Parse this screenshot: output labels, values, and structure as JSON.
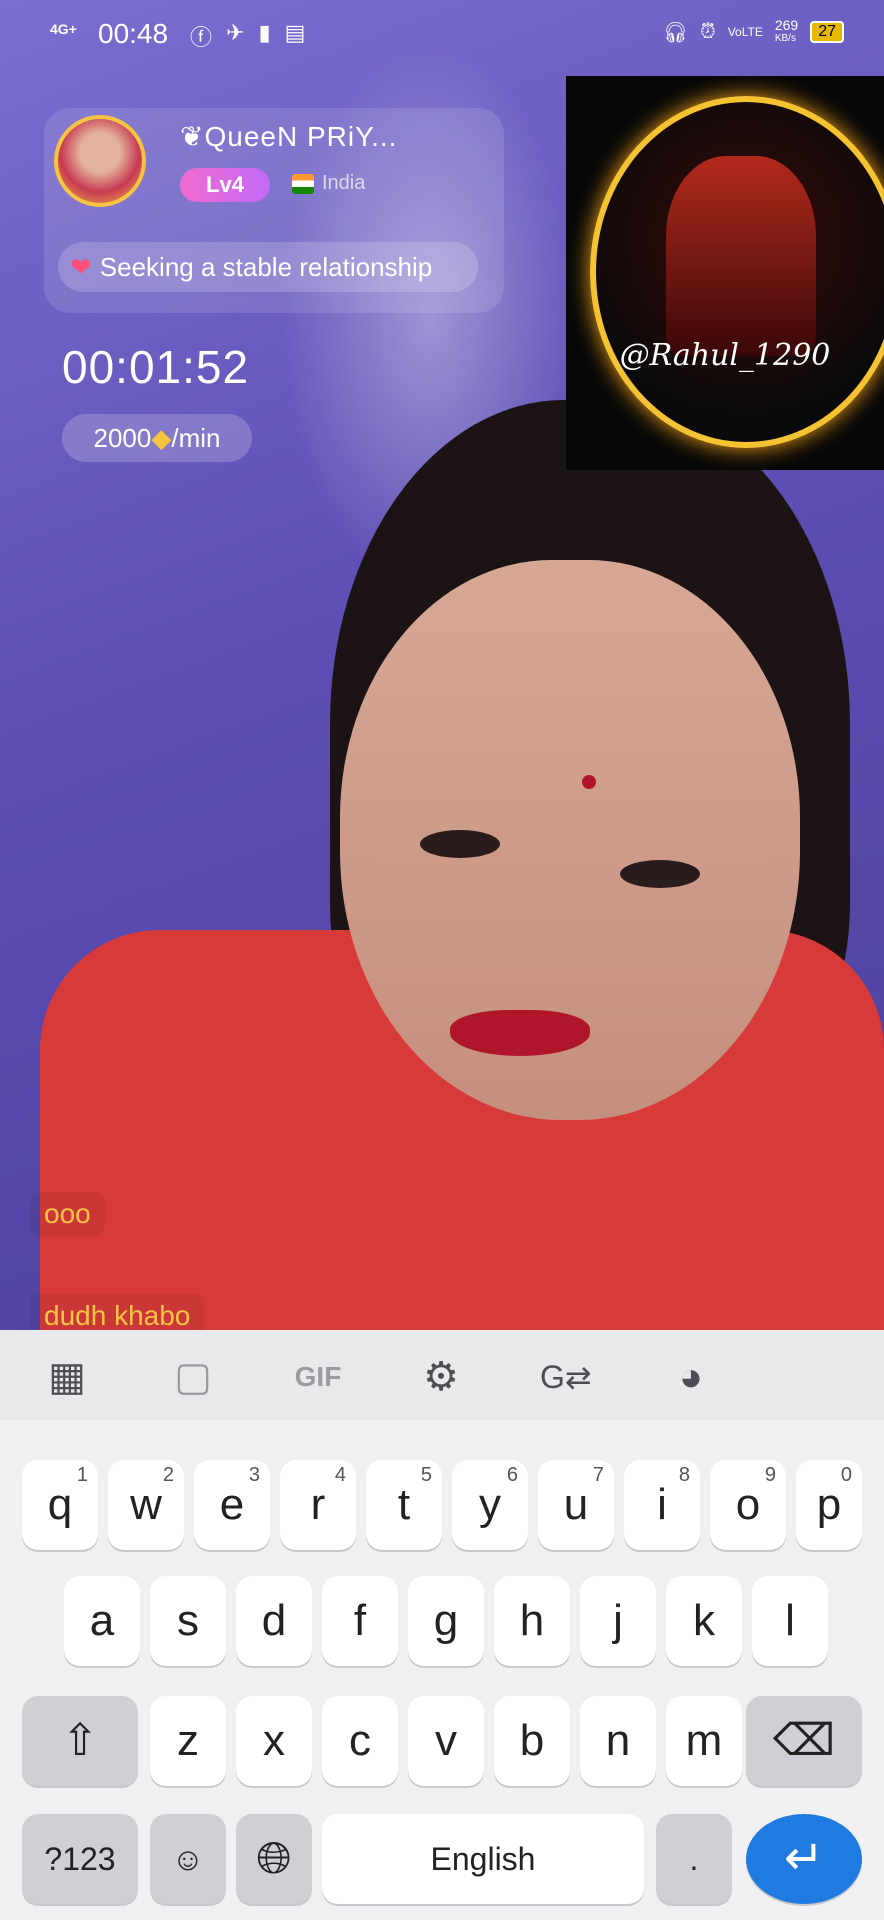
{
  "status_bar": {
    "network": "4G+",
    "time": "00:48",
    "speed": "269",
    "speed_unit": "KB/s",
    "volte": "VoLTE",
    "battery": "27"
  },
  "streamer": {
    "name": "❦QueeN PRiY...",
    "level": "Lv4",
    "country": "India",
    "status_text": "Seeking a stable relationship"
  },
  "call": {
    "timer": "00:01:52",
    "rate_amount": "2000",
    "rate_unit": "/min"
  },
  "overlay": {
    "handle": "@Rahul_1290"
  },
  "chat": {
    "messages": [
      "ooo",
      "dudh khabo"
    ]
  },
  "keyboard": {
    "toolbar": [
      "apps-icon",
      "sticker-icon",
      "GIF",
      "settings-icon",
      "translate-icon",
      "palette-icon"
    ],
    "gif_label": "GIF",
    "row1": [
      {
        "k": "q",
        "h": "1"
      },
      {
        "k": "w",
        "h": "2"
      },
      {
        "k": "e",
        "h": "3"
      },
      {
        "k": "r",
        "h": "4"
      },
      {
        "k": "t",
        "h": "5"
      },
      {
        "k": "y",
        "h": "6"
      },
      {
        "k": "u",
        "h": "7"
      },
      {
        "k": "i",
        "h": "8"
      },
      {
        "k": "o",
        "h": "9"
      },
      {
        "k": "p",
        "h": "0"
      }
    ],
    "row2": [
      "a",
      "s",
      "d",
      "f",
      "g",
      "h",
      "j",
      "k",
      "l"
    ],
    "row3": [
      "z",
      "x",
      "c",
      "v",
      "b",
      "n",
      "m"
    ],
    "symbols_label": "?123",
    "space_label": "English"
  },
  "colors": {
    "accent": "#1f7be0",
    "chat_text": "#f6c542",
    "level_badge": "#e46ad6"
  }
}
